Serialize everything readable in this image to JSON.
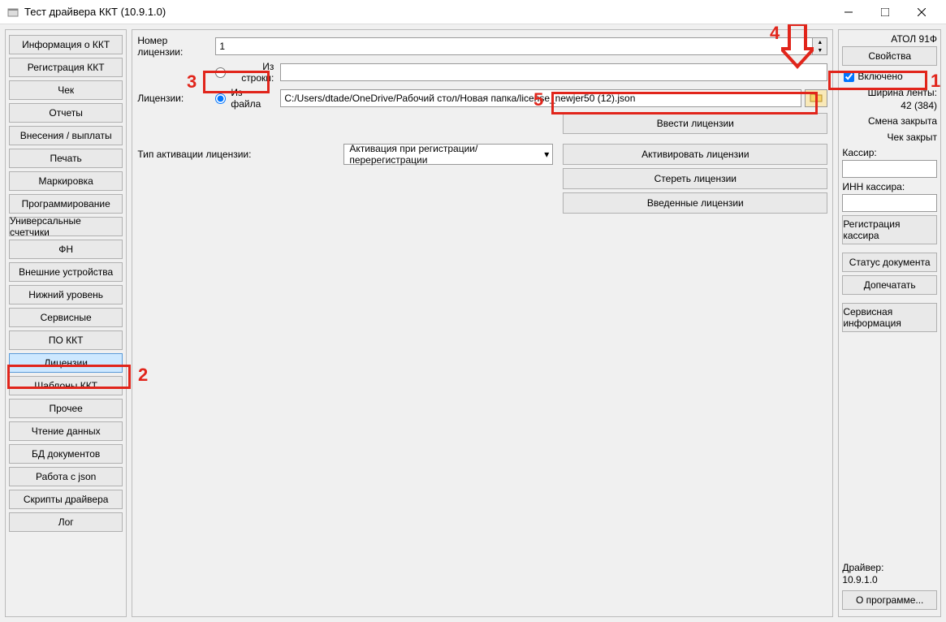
{
  "window": {
    "title": "Тест драйвера ККТ (10.9.1.0)"
  },
  "sidebar": {
    "items": [
      "Информация о ККТ",
      "Регистрация ККТ",
      "Чек",
      "Отчеты",
      "Внесения / выплаты",
      "Печать",
      "Маркировка",
      "Программирование",
      "Универсальные счетчики",
      "ФН",
      "Внешние устройства",
      "Нижний уровень",
      "Сервисные",
      "ПО ККТ",
      "Лицензии",
      "Шаблоны ККТ",
      "Прочее",
      "Чтение данных",
      "БД документов",
      "Работа с json",
      "Скрипты драйвера",
      "Лог"
    ],
    "selected_index": 14
  },
  "main": {
    "license_number_label": "Номер лицензии:",
    "license_number_value": "1",
    "licenses_label": "Лицензии:",
    "radio_string": "Из строки:",
    "radio_file": "Из файла",
    "radio_selected": "file",
    "string_value": "",
    "file_path": "C:/Users/dtade/OneDrive/Рабочий стол/Новая папка/license_newjer50 (12).json",
    "enter_btn": "Ввести лицензии",
    "activation_type_label": "Тип активации лицензии:",
    "activation_type_value": "Активация при регистрации/перерегистрации",
    "activate_btn": "Активировать лицензии",
    "erase_btn": "Стереть лицензии",
    "entered_btn": "Введенные лицензии"
  },
  "right": {
    "device": "АТОЛ 91Ф",
    "properties_btn": "Свойства",
    "enabled_label": "Включено",
    "enabled": true,
    "tape_width_label": "Ширина ленты:",
    "tape_width_value": "42 (384)",
    "shift_closed": "Смена закрыта",
    "check_closed": "Чек закрыт",
    "cashier_label": "Кассир:",
    "cashier_value": "",
    "cashier_inn_label": "ИНН кассира:",
    "cashier_inn_value": "",
    "reg_cashier_btn": "Регистрация кассира",
    "doc_status_btn": "Статус документа",
    "reprint_btn": "Допечатать",
    "service_info_btn": "Сервисная информация",
    "driver_label": "Драйвер:",
    "driver_version": "10.9.1.0",
    "about_btn": "О программе..."
  },
  "annotations": {
    "n1": "1",
    "n2": "2",
    "n3": "3",
    "n4": "4",
    "n5": "5"
  }
}
